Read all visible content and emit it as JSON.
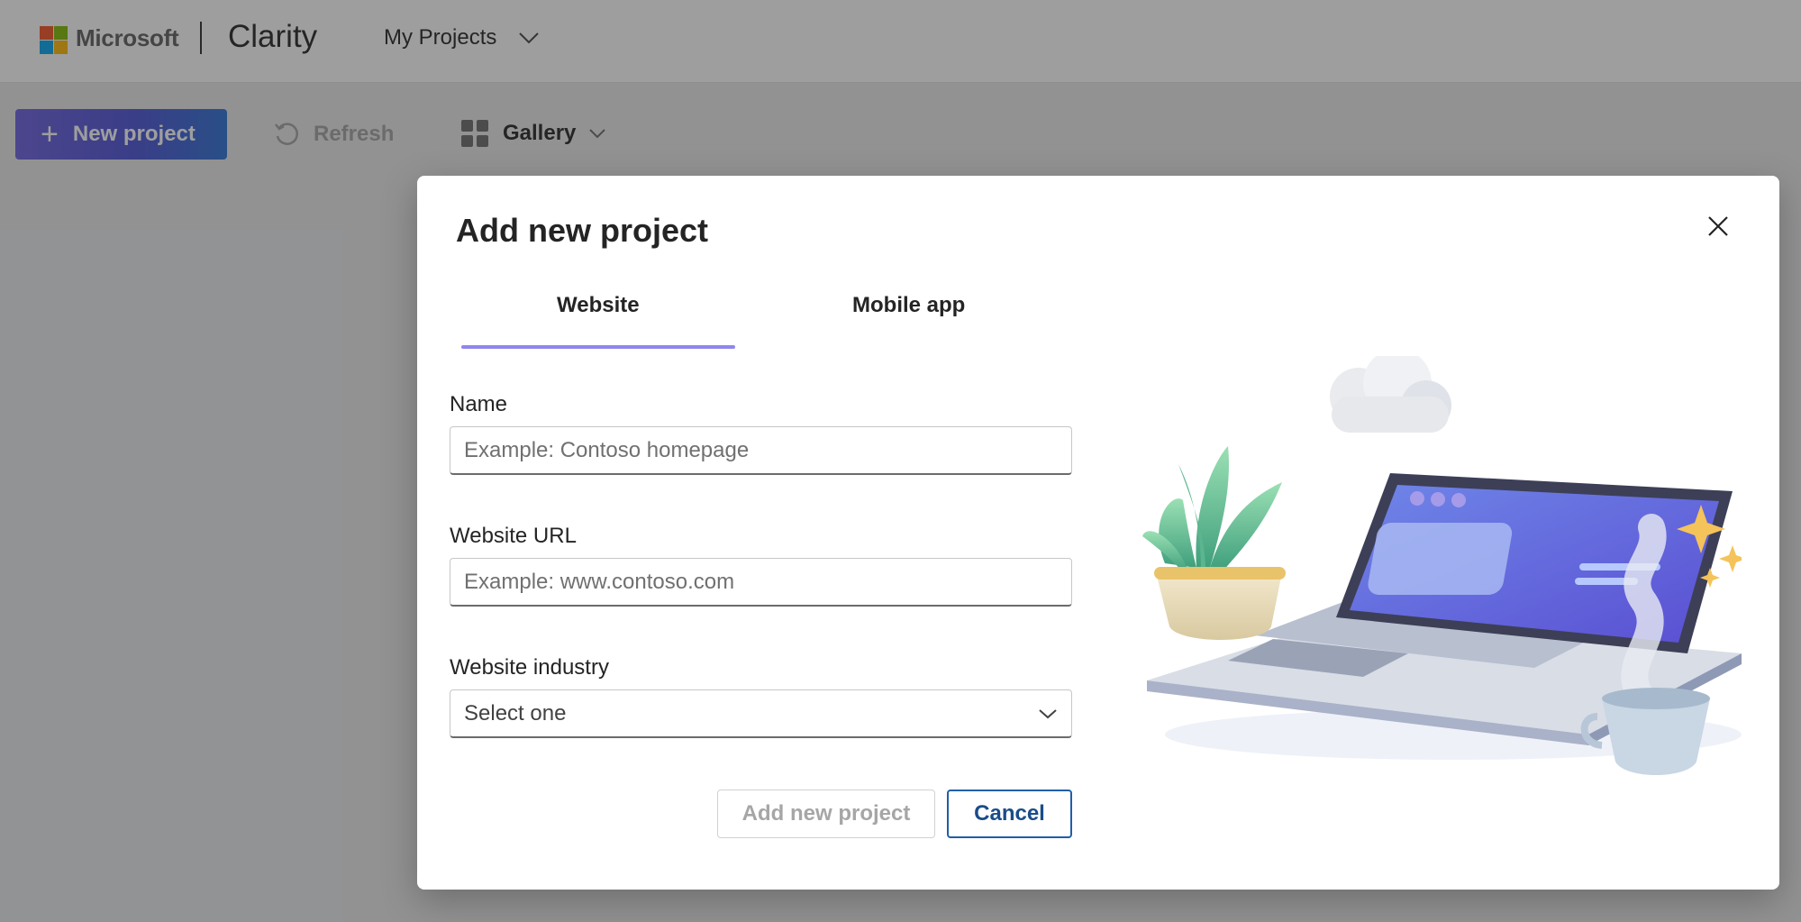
{
  "header": {
    "brand": "Microsoft",
    "app_name": "Clarity",
    "project_switcher": "My Projects",
    "logo_colors": [
      "#f25022",
      "#7fba00",
      "#00a4ef",
      "#ffb900"
    ]
  },
  "toolbar": {
    "new_project": "New project",
    "refresh": "Refresh",
    "view": "Gallery"
  },
  "dialog": {
    "title": "Add new project",
    "tabs": [
      {
        "label": "Website",
        "selected": true
      },
      {
        "label": "Mobile app",
        "selected": false
      }
    ],
    "fields": {
      "name": {
        "label": "Name",
        "value": "",
        "placeholder": "Example: Contoso homepage"
      },
      "url": {
        "label": "Website URL",
        "value": "",
        "placeholder": "Example: www.contoso.com"
      },
      "industry": {
        "label": "Website industry",
        "selected": "Select one"
      }
    },
    "buttons": {
      "add": "Add new project",
      "cancel": "Cancel"
    }
  },
  "colors": {
    "accent": "#8f86ee",
    "primary_button_gradient": [
      "#6a5fe0",
      "#2b6fd6"
    ],
    "cancel_border": "#1f5fa8"
  }
}
